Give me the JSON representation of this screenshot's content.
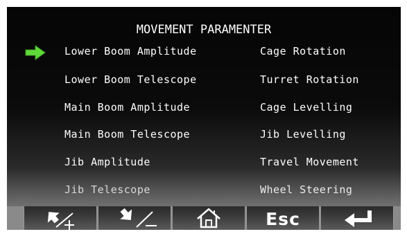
{
  "title": "MOVEMENT PARAMENTER",
  "colors": {
    "selector_arrow": "#5fd93a",
    "text": "#ffffff"
  },
  "left_column": [
    "Lower Boom Amplitude",
    "Lower Boom Telescope",
    "Main Boom Amplitude",
    "Main Boom Telescope",
    "Jib Amplitude",
    "Jib Telescope"
  ],
  "right_column": [
    "Cage Rotation",
    "Turret Rotation",
    "Cage Levelling",
    "Jib Levelling",
    "Travel Movement",
    "Wheel Steering"
  ],
  "toolbar": {
    "up_plus_icon": "up-arrow-plus-icon",
    "down_minus_icon": "down-arrow-minus-icon",
    "home_icon": "home-icon",
    "esc_label": "Esc",
    "enter_icon": "enter-return-icon"
  }
}
